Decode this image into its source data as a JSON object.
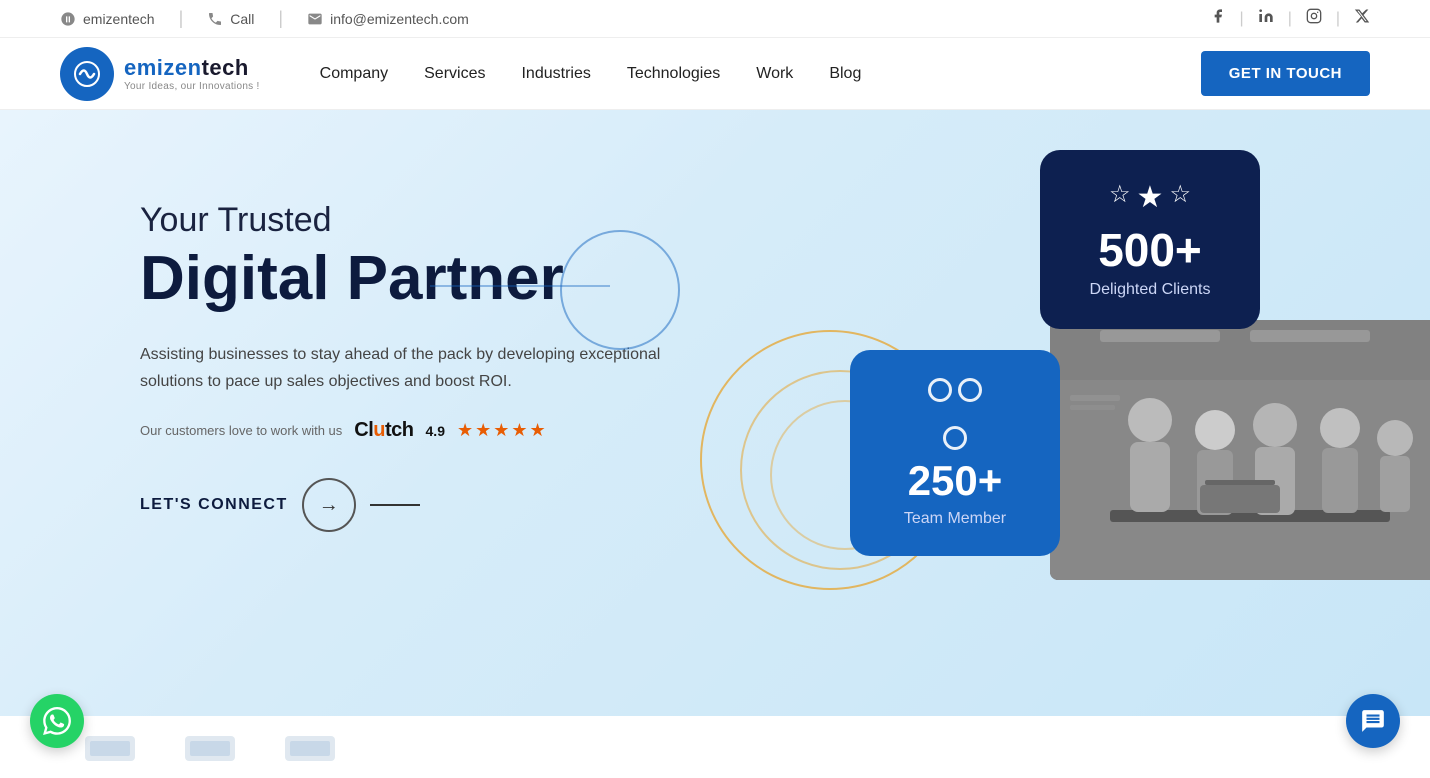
{
  "topbar": {
    "skype": "emizentech",
    "call": "Call",
    "email": "info@emizentech.com",
    "skype_icon": "skype-icon",
    "phone_icon": "phone-icon",
    "mail_icon": "mail-icon"
  },
  "social": {
    "facebook": "f",
    "linkedin": "in",
    "instagram": "ig",
    "twitter": "x"
  },
  "nav": {
    "logo_name": "emizentech",
    "logo_tagline": "Your Ideas, our Innovations !",
    "company": "Company",
    "services": "Services",
    "industries": "Industries",
    "technologies": "Technologies",
    "work": "Work",
    "blog": "Blog",
    "get_in_touch": "GET IN TOUCH"
  },
  "hero": {
    "subtitle": "Your Trusted",
    "title": "Digital Partner",
    "description": "Assisting businesses to stay ahead of the pack by developing exceptional solutions to pace up sales objectives and boost ROI.",
    "clutch_prefix": "Our customers love to work with us",
    "clutch_brand": "Clutch",
    "clutch_rating": "4.9",
    "stars": "★★★★★",
    "lets_connect": "LET'S CONNECT"
  },
  "card_clients": {
    "number": "500+",
    "label": "Delighted Clients"
  },
  "card_team": {
    "number": "250+",
    "label": "Team Member"
  },
  "floating": {
    "whatsapp_label": "WhatsApp",
    "chat_label": "Chat"
  }
}
